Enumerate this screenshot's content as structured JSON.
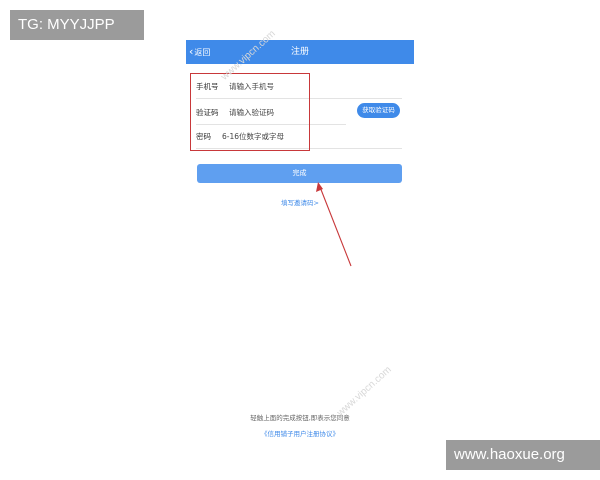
{
  "watermarks": {
    "top_left": "TG: MYYJJPP",
    "bottom_right": "www.haoxue.org",
    "diagonal": "www.vipcn.com"
  },
  "appbar": {
    "back_label": "返回",
    "back_icon": "chevron-left-icon",
    "title": "注册"
  },
  "form": {
    "phone": {
      "label": "手机号",
      "placeholder": "请输入手机号"
    },
    "code": {
      "label": "验证码",
      "placeholder": "请输入验证码",
      "button": "获取验证码"
    },
    "password": {
      "label": "密码",
      "placeholder": "6-16位数字或字母"
    }
  },
  "done_button": "完成",
  "invite_link": "填写邀请码>",
  "footer": {
    "consent": "轻触上面的完成按钮,即表示您同意",
    "agreement_link": "《信用铺子用户注册协议》"
  },
  "colors": {
    "primary": "#3f8ae9",
    "button": "#5f9ff0",
    "annotation": "#c8383a"
  }
}
